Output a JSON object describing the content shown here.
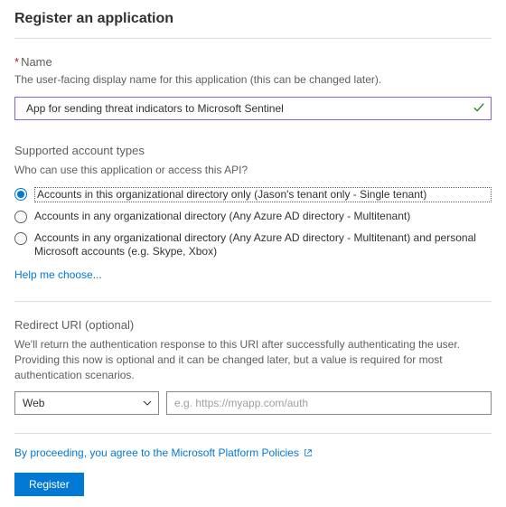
{
  "page": {
    "title": "Register an application"
  },
  "name": {
    "label": "Name",
    "description": "The user-facing display name for this application (this can be changed later).",
    "value": "App for sending threat indicators to Microsoft Sentinel"
  },
  "accountTypes": {
    "title": "Supported account types",
    "question": "Who can use this application or access this API?",
    "options": [
      "Accounts in this organizational directory only (Jason's tenant only - Single tenant)",
      "Accounts in any organizational directory (Any Azure AD directory - Multitenant)",
      "Accounts in any organizational directory (Any Azure AD directory - Multitenant) and personal Microsoft accounts (e.g. Skype, Xbox)"
    ],
    "helpLink": "Help me choose..."
  },
  "redirect": {
    "title": "Redirect URI (optional)",
    "description": "We'll return the authentication response to this URI after successfully authenticating the user. Providing this now is optional and it can be changed later, but a value is required for most authentication scenarios.",
    "platform": "Web",
    "uriPlaceholder": "e.g. https://myapp.com/auth"
  },
  "footer": {
    "policyText": "By proceeding, you agree to the Microsoft Platform Policies",
    "registerLabel": "Register"
  }
}
